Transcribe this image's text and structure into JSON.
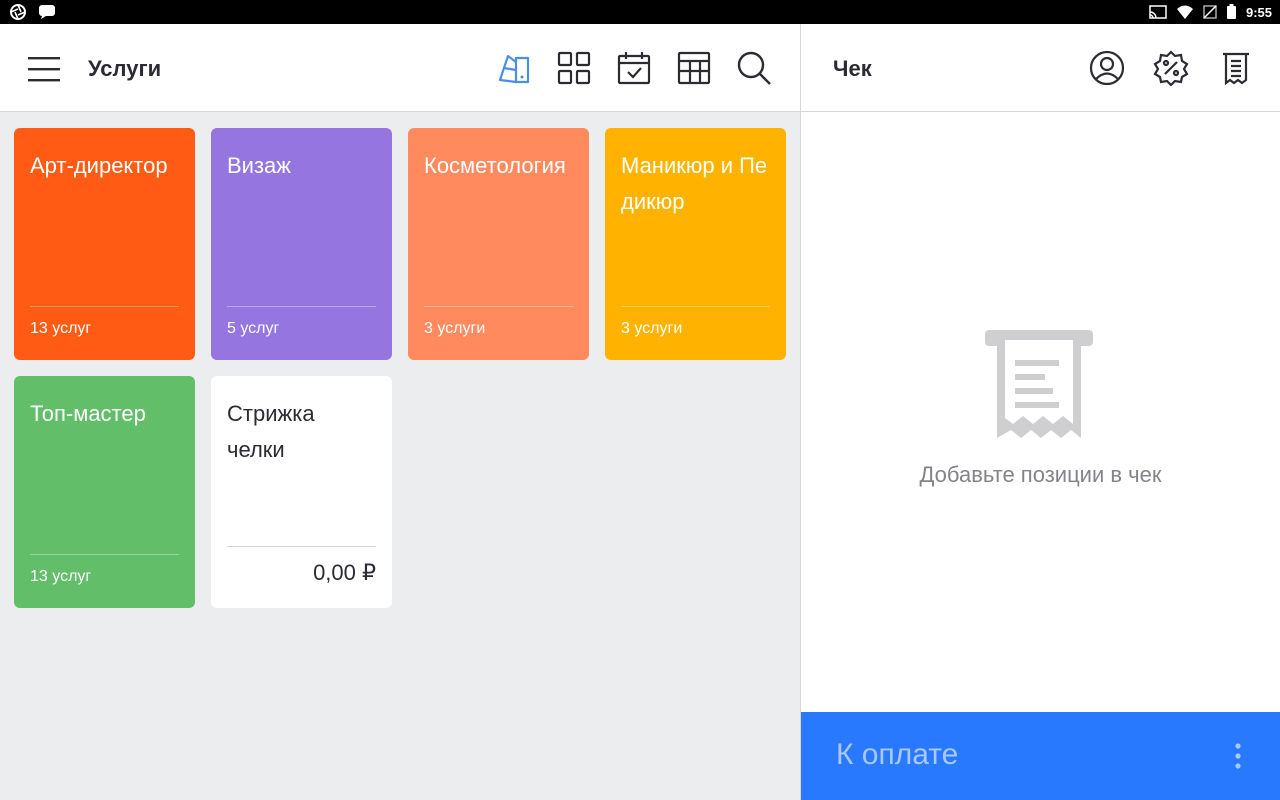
{
  "status_bar": {
    "time": "9:55",
    "left_icons": [
      "aperture-icon",
      "chat-bubble-icon"
    ],
    "right_icons": [
      "cast-icon",
      "wifi-icon",
      "no-sim-icon",
      "battery-icon"
    ]
  },
  "left_panel": {
    "title": "Услуги",
    "toolbar": [
      "color-palette-icon",
      "grid-view-icon",
      "calendar-check-icon",
      "table-view-icon",
      "search-icon"
    ],
    "accent_color": "#4A90E2",
    "tiles": [
      {
        "name": "Арт-директор",
        "count": "13 услуг",
        "color": "#FF5B14"
      },
      {
        "name": "Визаж",
        "count": "5 услуг",
        "color": "#9575DF"
      },
      {
        "name": "Косметология",
        "count": "3 услуги",
        "color": "#FF8A5E"
      },
      {
        "name": "Маникюр и Педикюр",
        "count": "3 услуги",
        "color": "#FFB300"
      },
      {
        "name": "Топ-мастер",
        "count": "13 услуг",
        "color": "#63BE6A"
      },
      {
        "name": "Стрижка челки",
        "price": "0,00 ₽",
        "color": "#FFFFFF"
      }
    ]
  },
  "right_panel": {
    "title": "Чек",
    "icons": [
      "user-circle-icon",
      "discount-badge-icon",
      "receipt-list-icon"
    ],
    "empty_message": "Добавьте позиции в чек",
    "pay_button": {
      "label": "К оплате",
      "color": "#2979FF"
    }
  }
}
